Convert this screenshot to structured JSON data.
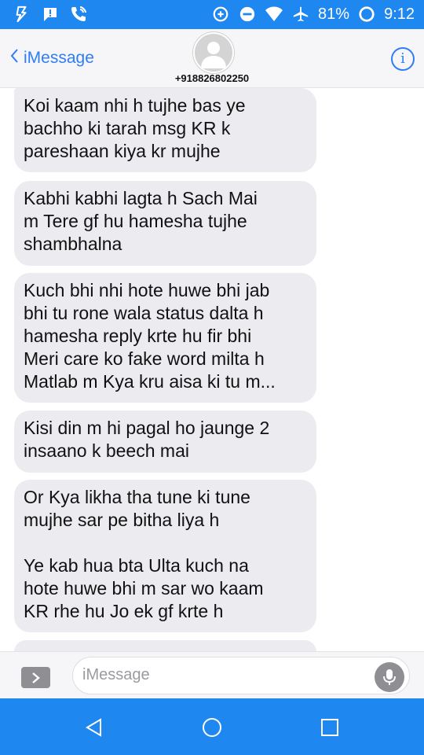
{
  "status_bar": {
    "battery": "81%",
    "time": "9:12"
  },
  "header": {
    "back_label": "iMessage",
    "contact_number": "+918826802250"
  },
  "messages": [
    {
      "text": "Koi kaam nhi h tujhe bas ye\nbachho ki tarah msg KR k\npareshaan kiya kr mujhe"
    },
    {
      "text": "Kabhi kabhi lagta h Sach Mai\nm Tere gf hu hamesha tujhe\nshambhalna"
    },
    {
      "text": "Kuch bhi nhi hote huwe bhi jab\nbhi tu rone wala status dalta h\nhamesha reply krte hu fir bhi\nMeri care ko fake word milta h\nMatlab m Kya kru aisa ki tu m..."
    },
    {
      "text": "Kisi din m hi pagal ho jaunge 2\ninsaano k beech mai"
    },
    {
      "text": "Or Kya likha tha tune ki tune\nmujhe sar pe bitha liya h\n\nYe kab hua bta Ulta kuch na\nhote huwe bhi m sar wo kaam\nKR rhe hu Jo ek gf krte h"
    }
  ],
  "composer": {
    "placeholder": "iMessage"
  },
  "colors": {
    "accent": "#2f7df6",
    "system_bar": "#1f87f0",
    "bubble": "#ececf0"
  }
}
